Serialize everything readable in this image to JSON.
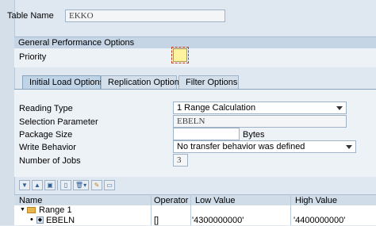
{
  "header": {
    "table_name_label": "Table Name",
    "table_name_value": "EKKO"
  },
  "performance": {
    "section_title": "General Performance Options",
    "priority_label": "Priority"
  },
  "tabs": [
    {
      "label": "Initial Load Options",
      "active": true
    },
    {
      "label": "Replication Options",
      "active": false
    },
    {
      "label": "Filter Options",
      "active": false
    }
  ],
  "form": {
    "reading_type_label": "Reading Type",
    "reading_type_value": "1 Range Calculation",
    "selection_parameter_label": "Selection Parameter",
    "selection_parameter_value": "EBELN",
    "package_size_label": "Package Size",
    "package_size_value": "",
    "package_size_unit": "Bytes",
    "write_behavior_label": "Write Behavior",
    "write_behavior_value": "No transfer behavior was defined",
    "jobs_label": "Number of Jobs",
    "jobs_value": "3"
  },
  "toolbar": {
    "buttons": [
      "expand-all-icon",
      "collapse-all-icon",
      "select-icon",
      "add-row-icon",
      "delete-row-icon",
      "edit-icon",
      "insert-icon"
    ]
  },
  "grid": {
    "columns": [
      "Name",
      "Operator",
      "Low Value",
      "High Value"
    ],
    "rows": [
      {
        "name": "Range 1",
        "operator": "",
        "low": "",
        "high": ""
      },
      {
        "name": "EBELN",
        "operator": "[]",
        "low": "'4300000000'",
        "high": "'4400000000'"
      }
    ]
  },
  "colors": {
    "background": "#dfe8f1",
    "section_header": "#c5d5e5",
    "priority_box": "#fff3a0",
    "folder": "#e8b64a"
  }
}
